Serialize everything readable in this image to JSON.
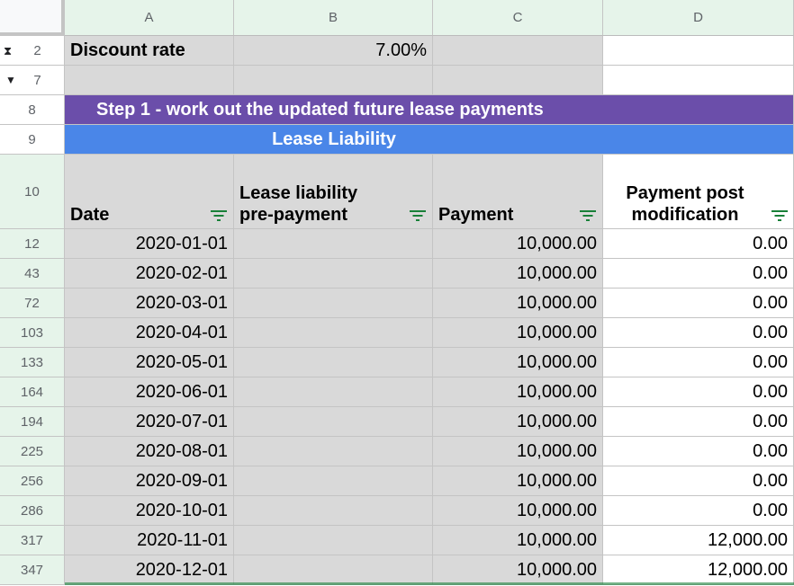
{
  "column_headers": [
    "A",
    "B",
    "C",
    "D"
  ],
  "rows": {
    "discount": {
      "num": "2",
      "label": "Discount rate",
      "value": "7.00%"
    },
    "blank": {
      "num": "7"
    },
    "step": {
      "num": "8",
      "text": "Step 1 - work out the updated future lease payments"
    },
    "section": {
      "num": "9",
      "text": "Lease Liability"
    },
    "header": {
      "num": "10",
      "date": "Date",
      "ll_line1": "Lease liability",
      "ll_line2": "pre-payment",
      "payment": "Payment",
      "pm_line1": "Payment post",
      "pm_line2": "modification"
    }
  },
  "data_rows": [
    {
      "num": "12",
      "date": "2020-01-01",
      "payment": "10,000.00",
      "post": "0.00"
    },
    {
      "num": "43",
      "date": "2020-02-01",
      "payment": "10,000.00",
      "post": "0.00"
    },
    {
      "num": "72",
      "date": "2020-03-01",
      "payment": "10,000.00",
      "post": "0.00"
    },
    {
      "num": "103",
      "date": "2020-04-01",
      "payment": "10,000.00",
      "post": "0.00"
    },
    {
      "num": "133",
      "date": "2020-05-01",
      "payment": "10,000.00",
      "post": "0.00"
    },
    {
      "num": "164",
      "date": "2020-06-01",
      "payment": "10,000.00",
      "post": "0.00"
    },
    {
      "num": "194",
      "date": "2020-07-01",
      "payment": "10,000.00",
      "post": "0.00"
    },
    {
      "num": "225",
      "date": "2020-08-01",
      "payment": "10,000.00",
      "post": "0.00"
    },
    {
      "num": "256",
      "date": "2020-09-01",
      "payment": "10,000.00",
      "post": "0.00"
    },
    {
      "num": "286",
      "date": "2020-10-01",
      "payment": "10,000.00",
      "post": "0.00"
    },
    {
      "num": "317",
      "date": "2020-11-01",
      "payment": "10,000.00",
      "post": "12,000.00"
    },
    {
      "num": "347",
      "date": "2020-12-01",
      "payment": "10,000.00",
      "post": "12,000.00"
    }
  ],
  "colors": {
    "step_banner": "#6b4eaa",
    "section_banner": "#4a86e8",
    "grey_cell": "#d9d9d9",
    "filter_icon": "#188038",
    "header_highlight": "#e6f4ea"
  }
}
